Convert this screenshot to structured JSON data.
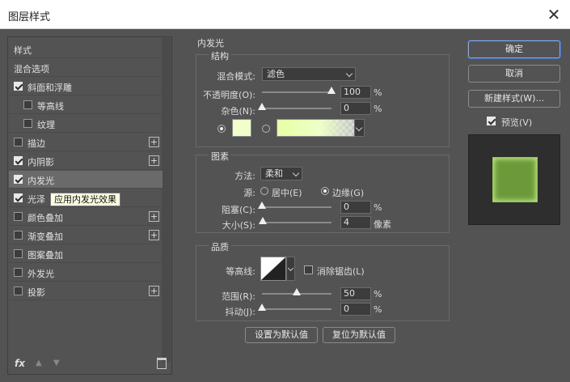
{
  "window": {
    "title": "图层样式",
    "close": "✕"
  },
  "sidebar": {
    "items": [
      {
        "label": "样式",
        "checkbox": false,
        "plus": false
      },
      {
        "label": "混合选项",
        "checkbox": false,
        "plus": false
      },
      {
        "label": "斜面和浮雕",
        "checkbox": true,
        "checked": true,
        "plus": false
      },
      {
        "label": "等高线",
        "checkbox": true,
        "checked": false,
        "plus": false,
        "indent": true
      },
      {
        "label": "纹理",
        "checkbox": true,
        "checked": false,
        "plus": false,
        "indent": true
      },
      {
        "label": "描边",
        "checkbox": true,
        "checked": false,
        "plus": true
      },
      {
        "label": "内阴影",
        "checkbox": true,
        "checked": true,
        "plus": true
      },
      {
        "label": "内发光",
        "checkbox": true,
        "checked": true,
        "plus": false,
        "selected": true
      },
      {
        "label": "光泽",
        "checkbox": true,
        "checked": true,
        "plus": false
      },
      {
        "label": "颜色叠加",
        "checkbox": true,
        "checked": false,
        "plus": true
      },
      {
        "label": "渐变叠加",
        "checkbox": true,
        "checked": false,
        "plus": true
      },
      {
        "label": "图案叠加",
        "checkbox": true,
        "checked": false,
        "plus": false
      },
      {
        "label": "外发光",
        "checkbox": true,
        "checked": false,
        "plus": false
      },
      {
        "label": "投影",
        "checkbox": true,
        "checked": false,
        "plus": true
      }
    ],
    "tooltip": "应用内发光效果",
    "plus_glyph": "+",
    "footer": {
      "fx": "fx",
      "up": "▲",
      "down": "▼"
    }
  },
  "panel": {
    "title": "内发光",
    "structure": {
      "title": "结构",
      "blend_mode_label": "混合模式:",
      "blend_mode_value": "滤色",
      "opacity_label": "不透明度(O):",
      "opacity_value": "100",
      "opacity_level": 100,
      "noise_label": "杂色(N):",
      "noise_value": "0",
      "noise_level": 0,
      "unit": "%",
      "color_swatch": "#f1ffcc",
      "gradient_start": "#e6ffa6"
    },
    "elements": {
      "title": "图素",
      "method_label": "方法:",
      "method_value": "柔和",
      "source_label": "源:",
      "source_center": "居中(E)",
      "source_edge": "边缘(G)",
      "choke_label": "阻塞(C):",
      "choke_value": "0",
      "choke_level": 0,
      "size_label": "大小(S):",
      "size_value": "4",
      "size_unit": "像素",
      "size_level": 4,
      "unit": "%"
    },
    "quality": {
      "title": "品质",
      "contour_label": "等高线:",
      "antialias_label": "消除锯齿(L)",
      "range_label": "范围(R):",
      "range_value": "50",
      "range_level": 50,
      "jitter_label": "抖动(J):",
      "jitter_value": "0",
      "jitter_level": 0,
      "unit": "%"
    },
    "set_default": "设置为默认值",
    "reset_default": "复位为默认值"
  },
  "right": {
    "ok": "确定",
    "cancel": "取消",
    "new_style": "新建样式(W)...",
    "preview_label": "预览(V)",
    "preview_color": "#6c9a3a"
  }
}
